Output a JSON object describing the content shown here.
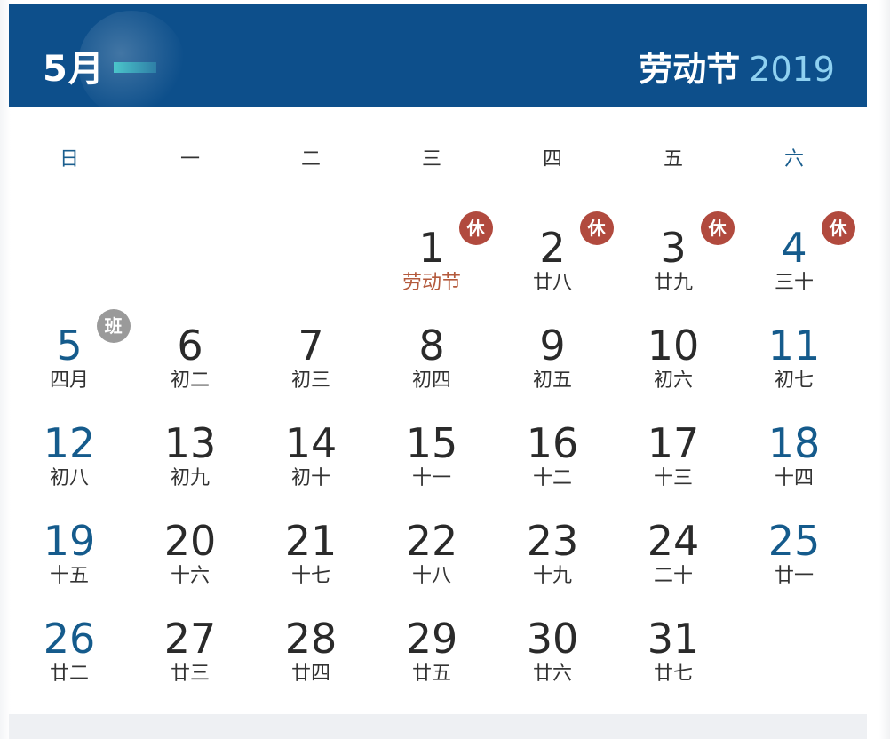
{
  "header": {
    "month": "5月",
    "festival": "劳动节",
    "year": "2019"
  },
  "weekdays": [
    "日",
    "一",
    "二",
    "三",
    "四",
    "五",
    "六"
  ],
  "days": [
    {
      "day": "1",
      "lunar": "劳动节",
      "col": 3,
      "row": 0,
      "badge": "休"
    },
    {
      "day": "2",
      "lunar": "廿八",
      "col": 4,
      "row": 0,
      "badge": "休"
    },
    {
      "day": "3",
      "lunar": "廿九",
      "col": 5,
      "row": 0,
      "badge": "休"
    },
    {
      "day": "4",
      "lunar": "三十",
      "col": 6,
      "row": 0,
      "badge": "休"
    },
    {
      "day": "5",
      "lunar": "四月",
      "col": 0,
      "row": 1,
      "badge": "班"
    },
    {
      "day": "6",
      "lunar": "初二",
      "col": 1,
      "row": 1
    },
    {
      "day": "7",
      "lunar": "初三",
      "col": 2,
      "row": 1
    },
    {
      "day": "8",
      "lunar": "初四",
      "col": 3,
      "row": 1
    },
    {
      "day": "9",
      "lunar": "初五",
      "col": 4,
      "row": 1
    },
    {
      "day": "10",
      "lunar": "初六",
      "col": 5,
      "row": 1
    },
    {
      "day": "11",
      "lunar": "初七",
      "col": 6,
      "row": 1
    },
    {
      "day": "12",
      "lunar": "初八",
      "col": 0,
      "row": 2
    },
    {
      "day": "13",
      "lunar": "初九",
      "col": 1,
      "row": 2
    },
    {
      "day": "14",
      "lunar": "初十",
      "col": 2,
      "row": 2
    },
    {
      "day": "15",
      "lunar": "十一",
      "col": 3,
      "row": 2
    },
    {
      "day": "16",
      "lunar": "十二",
      "col": 4,
      "row": 2
    },
    {
      "day": "17",
      "lunar": "十三",
      "col": 5,
      "row": 2
    },
    {
      "day": "18",
      "lunar": "十四",
      "col": 6,
      "row": 2
    },
    {
      "day": "19",
      "lunar": "十五",
      "col": 0,
      "row": 3
    },
    {
      "day": "20",
      "lunar": "十六",
      "col": 1,
      "row": 3
    },
    {
      "day": "21",
      "lunar": "十七",
      "col": 2,
      "row": 3
    },
    {
      "day": "22",
      "lunar": "十八",
      "col": 3,
      "row": 3
    },
    {
      "day": "23",
      "lunar": "十九",
      "col": 4,
      "row": 3
    },
    {
      "day": "24",
      "lunar": "二十",
      "col": 5,
      "row": 3
    },
    {
      "day": "25",
      "lunar": "廿一",
      "col": 6,
      "row": 3
    },
    {
      "day": "26",
      "lunar": "廿二",
      "col": 0,
      "row": 4
    },
    {
      "day": "27",
      "lunar": "廿三",
      "col": 1,
      "row": 4
    },
    {
      "day": "28",
      "lunar": "廿四",
      "col": 2,
      "row": 4
    },
    {
      "day": "29",
      "lunar": "廿五",
      "col": 3,
      "row": 4
    },
    {
      "day": "30",
      "lunar": "廿六",
      "col": 4,
      "row": 4
    },
    {
      "day": "31",
      "lunar": "廿七",
      "col": 5,
      "row": 4
    }
  ],
  "colors": {
    "header_bg": "#0d4f8b",
    "weekend_text": "#155b8c",
    "rest_badge": "#b14a3e",
    "work_badge": "#9a9a9a",
    "festival_lunar": "#b45a3c"
  }
}
